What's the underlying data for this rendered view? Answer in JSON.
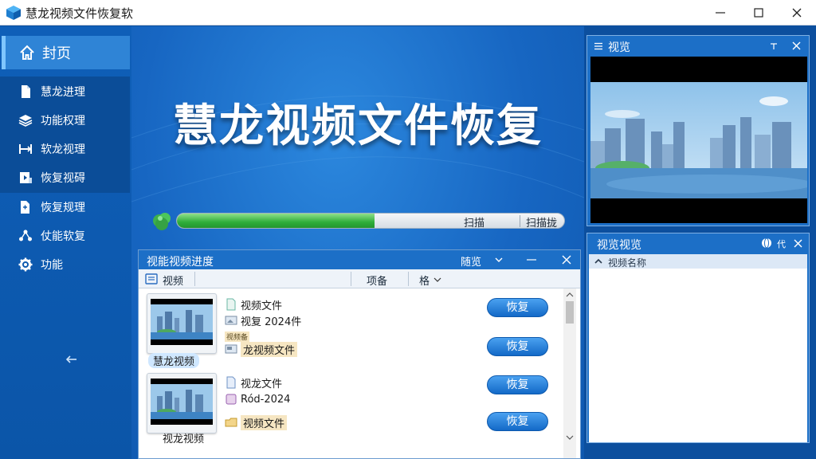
{
  "window": {
    "title": "慧龙视频文件恢复软"
  },
  "sidebar": {
    "home": "封页",
    "items": [
      {
        "label": "慧龙进理"
      },
      {
        "label": "功能权理"
      },
      {
        "label": "软龙视理"
      },
      {
        "label": "恢复视碍"
      },
      {
        "label": "恢复规理"
      },
      {
        "label": "仗能软复"
      },
      {
        "label": "功能"
      }
    ]
  },
  "main": {
    "title": "慧龙视频文件恢复",
    "progress": {
      "value": 0.51,
      "label": "扫描",
      "button": "扫描拢"
    }
  },
  "list_window": {
    "title": "视能视频进度",
    "view_label": "随览",
    "columns": {
      "name": "视频",
      "size": "项备",
      "sort": "格"
    },
    "rows": [
      {
        "thumb_caption": "慧龙视频",
        "file1": "视频文件",
        "file2": "视复 2024件",
        "tag": "视频备",
        "file3": "龙视频文件",
        "button1": "恢复",
        "button2": "恢复"
      },
      {
        "thumb_caption": "视龙视频",
        "file1": "视龙文件",
        "file2": "Ród-2024",
        "file3": "视频文件",
        "button1": "恢复",
        "button2": "恢复"
      }
    ]
  },
  "preview_panel": {
    "title": "视览"
  },
  "info_panel": {
    "title": "视览视览",
    "settings_label": "代",
    "selected_item": "视频名称"
  },
  "colors": {
    "accent": "#1c6fc7",
    "progress": "#2fae3a",
    "sidebar_active": "#2f84d6"
  },
  "icons": {
    "app": "app-cube-icon",
    "home": "home-icon",
    "doc": "document-icon",
    "layers": "layers-icon",
    "gear": "gear-icon",
    "close": "close-icon",
    "minimize": "minimize-icon",
    "maximize": "maximize-icon",
    "back": "arrow-left-icon"
  }
}
